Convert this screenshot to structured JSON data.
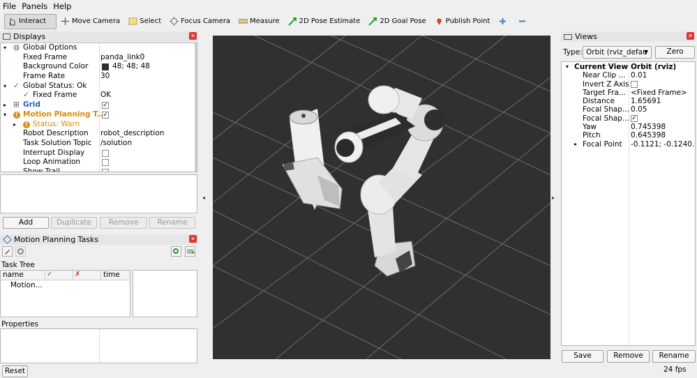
{
  "menu": {
    "file": "File",
    "panels": "Panels",
    "help": "Help"
  },
  "toolbar": {
    "interact": "Interact",
    "move_camera": "Move Camera",
    "select": "Select",
    "focus_camera": "Focus Camera",
    "measure": "Measure",
    "pose_estimate": "2D Pose Estimate",
    "goal_pose": "2D Goal Pose",
    "publish_point": "Publish Point"
  },
  "displays": {
    "title": "Displays",
    "rows": [
      {
        "label": "Global Options",
        "value": ""
      },
      {
        "label": "Fixed Frame",
        "value": "panda_link0"
      },
      {
        "label": "Background Color",
        "value": "48; 48; 48"
      },
      {
        "label": "Frame Rate",
        "value": "30"
      },
      {
        "label": "Global Status: Ok",
        "value": ""
      },
      {
        "label": "Fixed Frame",
        "value": "OK"
      },
      {
        "label": "Grid",
        "value": ""
      },
      {
        "label": "Motion Planning T...",
        "value": ""
      },
      {
        "label": "Status: Warn",
        "value": ""
      },
      {
        "label": "Robot Description",
        "value": "robot_description"
      },
      {
        "label": "Task Solution Topic",
        "value": "/solution"
      },
      {
        "label": "Interrupt Display",
        "value": ""
      },
      {
        "label": "Loop Animation",
        "value": ""
      },
      {
        "label": "Show Trail",
        "value": ""
      }
    ],
    "buttons": {
      "add": "Add",
      "duplicate": "Duplicate",
      "remove": "Remove",
      "rename": "Rename"
    }
  },
  "mpt": {
    "title": "Motion Planning Tasks",
    "task_tree_label": "Task Tree",
    "columns": [
      "name",
      "✓",
      "✗",
      "time"
    ],
    "rows": [
      "Motion..."
    ],
    "properties_label": "Properties"
  },
  "reset": "Reset",
  "views": {
    "title": "Views",
    "type_label": "Type:",
    "type_value": "Orbit (rviz_defau",
    "zero": "Zero",
    "rows": [
      {
        "label": "Current View",
        "value": "Orbit (rviz)"
      },
      {
        "label": "Near Clip ...",
        "value": "0.01"
      },
      {
        "label": "Invert Z Axis",
        "value": ""
      },
      {
        "label": "Target Fra...",
        "value": "<Fixed Frame>"
      },
      {
        "label": "Distance",
        "value": "1.65691"
      },
      {
        "label": "Focal Shap...",
        "value": "0.05"
      },
      {
        "label": "Focal Shap...",
        "value": ""
      },
      {
        "label": "Yaw",
        "value": "0.745398"
      },
      {
        "label": "Pitch",
        "value": "0.645398"
      },
      {
        "label": "Focal Point",
        "value": "-0.1121; -0.1240..."
      }
    ],
    "buttons": {
      "save": "Save",
      "remove": "Remove",
      "rename": "Rename"
    }
  },
  "status": {
    "fps": "24 fps"
  },
  "colors": {
    "viewport_bg": "#303030",
    "warn": "#d98c00",
    "ok": "#2a8a2a",
    "grid_label": "#1f5fbf"
  }
}
